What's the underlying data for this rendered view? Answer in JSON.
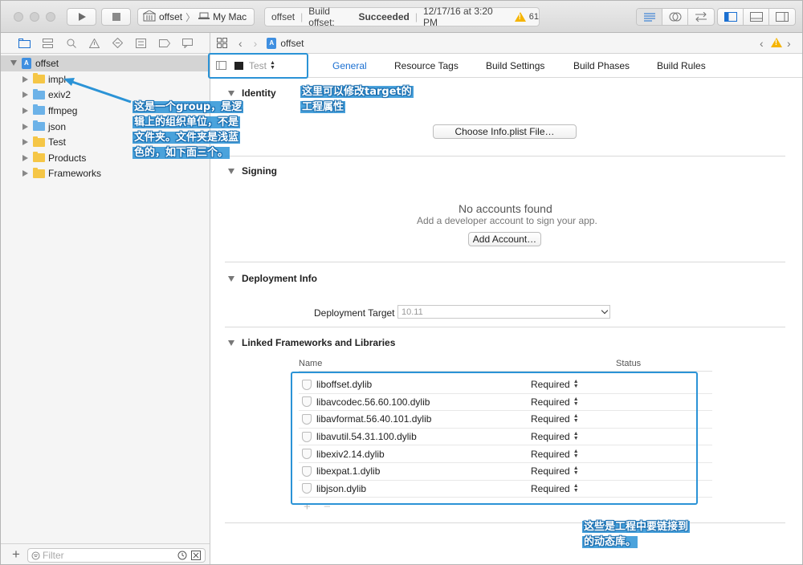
{
  "toolbar": {
    "scheme_target": "offset",
    "scheme_device": "My Mac",
    "activity_project": "offset",
    "activity_status_prefix": "Build offset:",
    "activity_status_value": "Succeeded",
    "activity_date": "12/17/16 at 3:20 PM",
    "warning_count": "61"
  },
  "navigator": {
    "project": "offset",
    "items": [
      {
        "label": "impl",
        "folder": "yellow"
      },
      {
        "label": "exiv2",
        "folder": "blue"
      },
      {
        "label": "ffmpeg",
        "folder": "blue"
      },
      {
        "label": "json",
        "folder": "blue"
      },
      {
        "label": "Test",
        "folder": "yellow"
      },
      {
        "label": "Products",
        "folder": "yellow"
      },
      {
        "label": "Frameworks",
        "folder": "yellow"
      }
    ],
    "filter_placeholder": "Filter"
  },
  "jumpbar": {
    "file": "offset"
  },
  "editor": {
    "target_name": "Test",
    "tabs": [
      "General",
      "Resource Tags",
      "Build Settings",
      "Build Phases",
      "Build Rules"
    ],
    "identity": {
      "title": "Identity",
      "choose_button": "Choose Info.plist File…"
    },
    "signing": {
      "title": "Signing",
      "no_accounts": "No accounts found",
      "hint": "Add a developer account to sign your app.",
      "add_button": "Add Account…"
    },
    "deployment": {
      "title": "Deployment Info",
      "target_label": "Deployment Target",
      "target_value": "10.11"
    },
    "linked": {
      "title": "Linked Frameworks and Libraries",
      "col_name": "Name",
      "col_status": "Status",
      "rows": [
        {
          "name": "liboffset.dylib",
          "status": "Required"
        },
        {
          "name": "libavcodec.56.60.100.dylib",
          "status": "Required"
        },
        {
          "name": "libavformat.56.40.101.dylib",
          "status": "Required"
        },
        {
          "name": "libavutil.54.31.100.dylib",
          "status": "Required"
        },
        {
          "name": "libexiv2.14.dylib",
          "status": "Required"
        },
        {
          "name": "libexpat.1.dylib",
          "status": "Required"
        },
        {
          "name": "libjson.dylib",
          "status": "Required"
        }
      ],
      "add_symbol": "+",
      "remove_symbol": "−"
    }
  },
  "annotations": {
    "group_note": [
      "这是一个group，是逻",
      "辑上的组织单位，不是",
      "文件夹。文件夹是浅蓝",
      "色的，如下面三个。"
    ],
    "target_note": [
      "这里可以修改target的",
      "工程属性"
    ],
    "libs_note": [
      "这些是工程中要链接到",
      "的动态库。"
    ]
  },
  "colors": {
    "accent": "#1a6fd1",
    "annotation": "#2b93d6",
    "folder_yellow": "#f5c646",
    "folder_blue": "#6cb2e8",
    "warning": "#f5b400"
  }
}
